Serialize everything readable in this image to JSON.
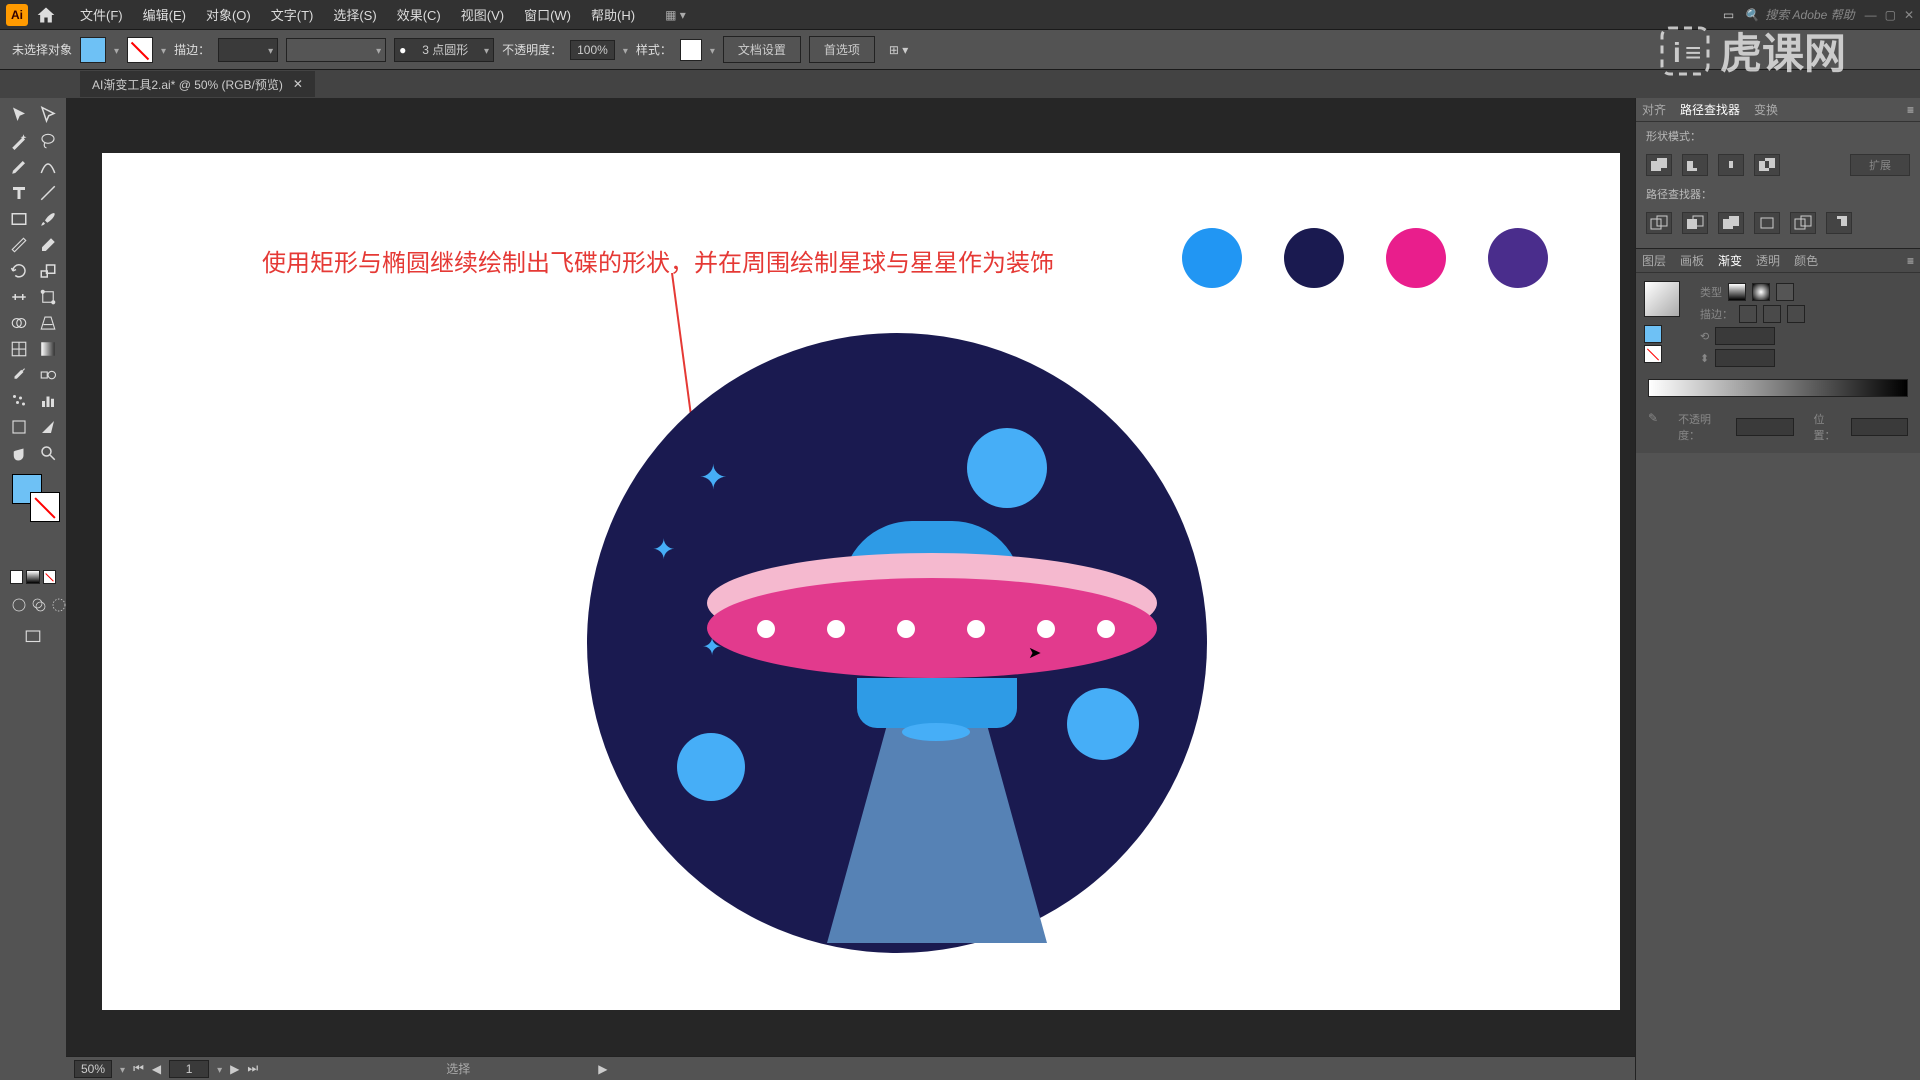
{
  "menu": {
    "items": [
      "文件(F)",
      "编辑(E)",
      "对象(O)",
      "文字(T)",
      "选择(S)",
      "效果(C)",
      "视图(V)",
      "窗口(W)",
      "帮助(H)"
    ],
    "search_placeholder": "搜索 Adobe 帮助"
  },
  "control_bar": {
    "selection_status": "未选择对象",
    "stroke_label": "描边：",
    "stroke_weight": "",
    "stroke_profile": "3 点圆形",
    "opacity_label": "不透明度：",
    "opacity_value": "100%",
    "style_label": "样式：",
    "doc_setup": "文档设置",
    "preferences": "首选项"
  },
  "document": {
    "tab_title": "AI渐变工具2.ai* @ 50% (RGB/预览)"
  },
  "annotation": {
    "text": "使用矩形与椭圆继续绘制出飞碟的形状，并在周围绘制星球与星星作为装饰"
  },
  "swatches": {
    "colors": [
      "#2196f3",
      "#1a1a50",
      "#e91e8c",
      "#4a2d8c"
    ]
  },
  "status_bar": {
    "zoom": "50%",
    "page": "1",
    "tool_hint": "选择"
  },
  "panels": {
    "align": {
      "tabs": [
        "对齐",
        "路径查找器",
        "变换"
      ],
      "active_tab": 1,
      "shape_mode_label": "形状模式：",
      "pathfinder_label": "路径查找器：",
      "expand_label": "扩展"
    },
    "gradient": {
      "tabs": [
        "图层",
        "画板",
        "渐变",
        "透明",
        "颜色"
      ],
      "active_tab": 2,
      "type_label": "类型",
      "stroke_label": "描边：",
      "opacity_label": "不透明度：",
      "position_label": "位置："
    }
  },
  "watermark": "虎课网"
}
